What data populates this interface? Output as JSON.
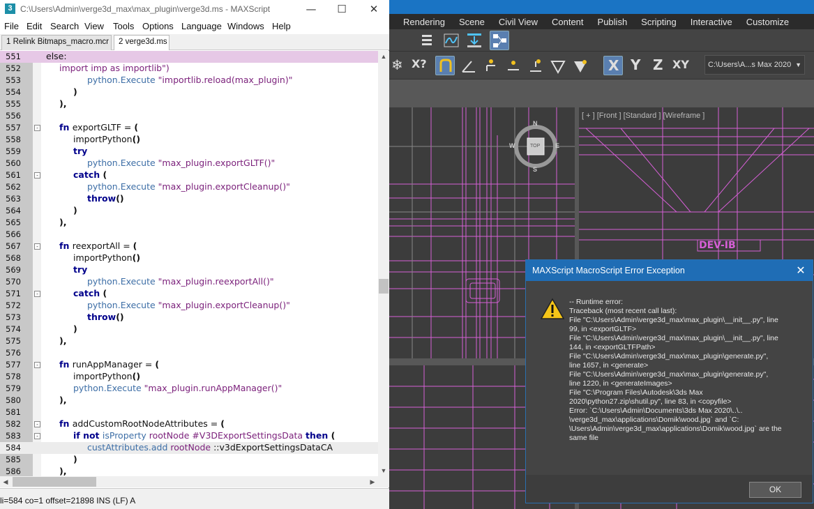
{
  "editor": {
    "title": "C:\\Users\\Admin\\verge3d_max\\max_plugin\\verge3d.ms - MAXScript",
    "app_icon_letter": "3",
    "menu": [
      "File",
      "Edit",
      "Search",
      "View",
      "Tools",
      "Options",
      "Language",
      "Windows",
      "Help"
    ],
    "tabs": [
      "1 Relink Bitmaps_macro.mcr",
      "2 verge3d.ms"
    ],
    "status": "li=584 co=1 offset=21898 INS (LF) A",
    "lines": [
      {
        "n": "551",
        "fold": "",
        "segs": [
          {
            "t": "else:",
            "c": "plain"
          }
        ],
        "indent": 0
      },
      {
        "n": "552",
        "fold": "",
        "segs": [
          {
            "t": "import imp as importlib\")",
            "c": "str"
          }
        ],
        "indent": 1
      },
      {
        "n": "553",
        "fold": "",
        "segs": [
          {
            "t": "python.Execute ",
            "c": "py"
          },
          {
            "t": "\"importlib.reload(max_plugin)\"",
            "c": "str"
          }
        ],
        "indent": 3
      },
      {
        "n": "554",
        "fold": "",
        "segs": [
          {
            "t": ")",
            "c": "dk"
          }
        ],
        "indent": 2
      },
      {
        "n": "555",
        "fold": "",
        "segs": [
          {
            "t": "),",
            "c": "dk"
          }
        ],
        "indent": 1
      },
      {
        "n": "556",
        "fold": "",
        "segs": [],
        "indent": 0
      },
      {
        "n": "557",
        "fold": "-",
        "segs": [
          {
            "t": "fn ",
            "c": "kw"
          },
          {
            "t": "exportGLTF = ",
            "c": "plain"
          },
          {
            "t": "(",
            "c": "dk"
          }
        ],
        "indent": 1
      },
      {
        "n": "558",
        "fold": "",
        "segs": [
          {
            "t": "importPython",
            "c": "plain"
          },
          {
            "t": "()",
            "c": "dk"
          }
        ],
        "indent": 2
      },
      {
        "n": "559",
        "fold": "",
        "segs": [
          {
            "t": "try",
            "c": "kw"
          }
        ],
        "indent": 2
      },
      {
        "n": "560",
        "fold": "",
        "segs": [
          {
            "t": "python.Execute ",
            "c": "py"
          },
          {
            "t": "\"max_plugin.exportGLTF()\"",
            "c": "str"
          }
        ],
        "indent": 3
      },
      {
        "n": "561",
        "fold": "-",
        "segs": [
          {
            "t": "catch ",
            "c": "kw"
          },
          {
            "t": "(",
            "c": "dk"
          }
        ],
        "indent": 2
      },
      {
        "n": "562",
        "fold": "",
        "segs": [
          {
            "t": "python.Execute ",
            "c": "py"
          },
          {
            "t": "\"max_plugin.exportCleanup()\"",
            "c": "str"
          }
        ],
        "indent": 3
      },
      {
        "n": "563",
        "fold": "",
        "segs": [
          {
            "t": "throw",
            "c": "kw"
          },
          {
            "t": "()",
            "c": "dk"
          }
        ],
        "indent": 3
      },
      {
        "n": "564",
        "fold": "",
        "segs": [
          {
            "t": ")",
            "c": "dk"
          }
        ],
        "indent": 2
      },
      {
        "n": "565",
        "fold": "",
        "segs": [
          {
            "t": "),",
            "c": "dk"
          }
        ],
        "indent": 1
      },
      {
        "n": "566",
        "fold": "",
        "segs": [],
        "indent": 0
      },
      {
        "n": "567",
        "fold": "-",
        "segs": [
          {
            "t": "fn ",
            "c": "kw"
          },
          {
            "t": "reexportAll = ",
            "c": "plain"
          },
          {
            "t": "(",
            "c": "dk"
          }
        ],
        "indent": 1
      },
      {
        "n": "568",
        "fold": "",
        "segs": [
          {
            "t": "importPython",
            "c": "plain"
          },
          {
            "t": "()",
            "c": "dk"
          }
        ],
        "indent": 2
      },
      {
        "n": "569",
        "fold": "",
        "segs": [
          {
            "t": "try",
            "c": "kw"
          }
        ],
        "indent": 2
      },
      {
        "n": "570",
        "fold": "",
        "segs": [
          {
            "t": "python.Execute ",
            "c": "py"
          },
          {
            "t": "\"max_plugin.reexportAll()\"",
            "c": "str"
          }
        ],
        "indent": 3
      },
      {
        "n": "571",
        "fold": "-",
        "segs": [
          {
            "t": "catch ",
            "c": "kw"
          },
          {
            "t": "(",
            "c": "dk"
          }
        ],
        "indent": 2
      },
      {
        "n": "572",
        "fold": "",
        "segs": [
          {
            "t": "python.Execute ",
            "c": "py"
          },
          {
            "t": "\"max_plugin.exportCleanup()\"",
            "c": "str"
          }
        ],
        "indent": 3
      },
      {
        "n": "573",
        "fold": "",
        "segs": [
          {
            "t": "throw",
            "c": "kw"
          },
          {
            "t": "()",
            "c": "dk"
          }
        ],
        "indent": 3
      },
      {
        "n": "574",
        "fold": "",
        "segs": [
          {
            "t": ")",
            "c": "dk"
          }
        ],
        "indent": 2
      },
      {
        "n": "575",
        "fold": "",
        "segs": [
          {
            "t": "),",
            "c": "dk"
          }
        ],
        "indent": 1
      },
      {
        "n": "576",
        "fold": "",
        "segs": [],
        "indent": 0
      },
      {
        "n": "577",
        "fold": "-",
        "segs": [
          {
            "t": "fn ",
            "c": "kw"
          },
          {
            "t": "runAppManager = ",
            "c": "plain"
          },
          {
            "t": "(",
            "c": "dk"
          }
        ],
        "indent": 1
      },
      {
        "n": "578",
        "fold": "",
        "segs": [
          {
            "t": "importPython",
            "c": "plain"
          },
          {
            "t": "()",
            "c": "dk"
          }
        ],
        "indent": 2
      },
      {
        "n": "579",
        "fold": "",
        "segs": [
          {
            "t": "python.Execute ",
            "c": "py"
          },
          {
            "t": "\"max_plugin.runAppManager()\"",
            "c": "str"
          }
        ],
        "indent": 2
      },
      {
        "n": "580",
        "fold": "",
        "segs": [
          {
            "t": "),",
            "c": "dk"
          }
        ],
        "indent": 1
      },
      {
        "n": "581",
        "fold": "",
        "segs": [],
        "indent": 0
      },
      {
        "n": "582",
        "fold": "-",
        "segs": [
          {
            "t": "fn ",
            "c": "kw"
          },
          {
            "t": "addCustomRootNodeAttributes = ",
            "c": "plain"
          },
          {
            "t": "(",
            "c": "dk"
          }
        ],
        "indent": 1
      },
      {
        "n": "583",
        "fold": "-",
        "segs": [
          {
            "t": "if not ",
            "c": "kw"
          },
          {
            "t": "isProperty ",
            "c": "py"
          },
          {
            "t": "rootNode ",
            "c": "str"
          },
          {
            "t": "#V3DExportSettingsData ",
            "c": "str"
          },
          {
            "t": "then ",
            "c": "kw"
          },
          {
            "t": "(",
            "c": "dk"
          }
        ],
        "indent": 2
      },
      {
        "n": "584",
        "fold": "",
        "segs": [
          {
            "t": "custAttributes.add ",
            "c": "py"
          },
          {
            "t": "rootNode ",
            "c": "str"
          },
          {
            "t": "::v3dExportSettingsDataCA",
            "c": "plain"
          }
        ],
        "indent": 3
      },
      {
        "n": "585",
        "fold": "",
        "segs": [
          {
            "t": ")",
            "c": "dk"
          }
        ],
        "indent": 2
      },
      {
        "n": "586",
        "fold": "",
        "segs": [
          {
            "t": "),",
            "c": "dk"
          }
        ],
        "indent": 1
      }
    ]
  },
  "max": {
    "menu": [
      "Rendering",
      "Scene",
      "Civil View",
      "Content",
      "Publish",
      "Scripting",
      "Interactive",
      "Customize"
    ],
    "axis_x": "X",
    "axis_y": "Y",
    "axis_z": "Z",
    "axis_xy": "XY",
    "path_dropdown": "C:\\Users\\A...s Max 2020",
    "viewport_front_label": "[ + ] [Front ] [Standard ] [Wireframe ]",
    "compass": {
      "n": "N",
      "s": "S",
      "e": "E",
      "w": "W",
      "cube": "TOP"
    },
    "wire_color": "#e060e0"
  },
  "dialog": {
    "title": "MAXScript MacroScript Error Exception",
    "close": "✕",
    "ok": "OK",
    "text_lines": [
      "-- Runtime error:",
      "Traceback (most recent call last):",
      "  File \"C:\\Users\\Admin\\verge3d_max\\max_plugin\\__init__.py\", line",
      "99, in <exportGLTF>",
      "  File \"C:\\Users\\Admin\\verge3d_max\\max_plugin\\__init__.py\", line",
      "144, in <exportGLTFPath>",
      "  File \"C:\\Users\\Admin\\verge3d_max\\max_plugin\\generate.py\",",
      "line 1657, in <generate>",
      "  File \"C:\\Users\\Admin\\verge3d_max\\max_plugin\\generate.py\",",
      "line 1220, in <generateImages>",
      "  File \"C:\\Program Files\\Autodesk\\3ds Max",
      "2020\\python27.zip\\shutil.py\", line 83, in <copyfile>",
      "Error: `C:\\Users\\Admin\\Documents\\3ds Max 2020\\..\\..",
      "\\verge3d_max\\applications\\Domik\\wood.jpg` and `C:",
      "\\Users\\Admin\\verge3d_max\\applications\\Domik\\wood.jpg` are the",
      "same file"
    ]
  }
}
